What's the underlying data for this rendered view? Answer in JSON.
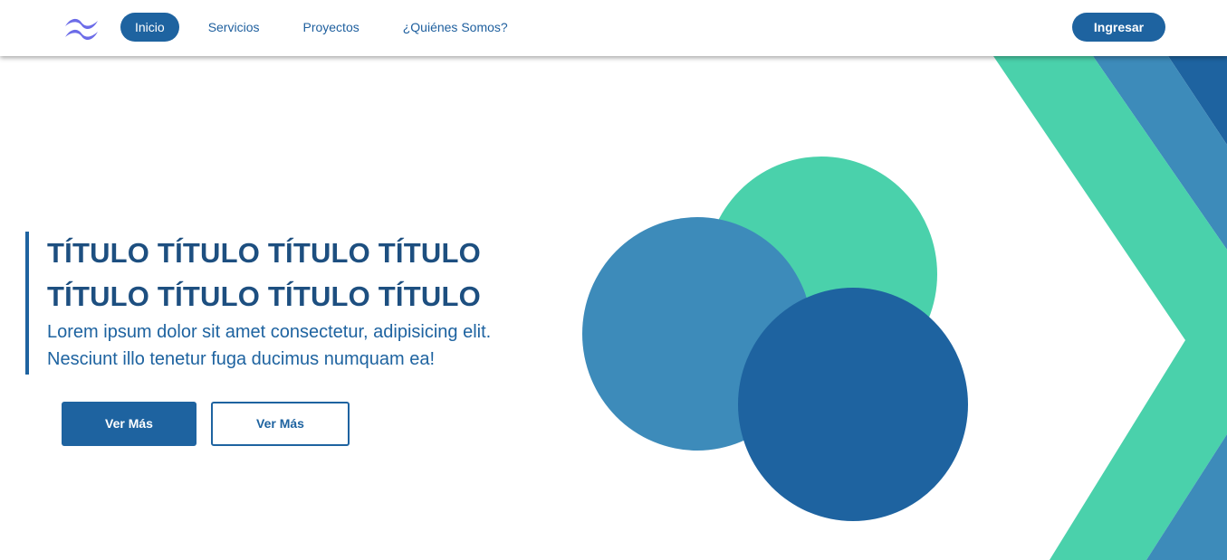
{
  "navbar": {
    "logo_icon": "tailwind-wave-logo",
    "items": [
      {
        "label": "Inicio",
        "active": true
      },
      {
        "label": "Servicios",
        "active": false
      },
      {
        "label": "Proyectos",
        "active": false
      },
      {
        "label": "¿Quiénes Somos?",
        "active": false
      }
    ],
    "login_label": "Ingresar"
  },
  "hero": {
    "title_line1": "TÍTULO TÍTULO TÍTULO TÍTULO",
    "title_line2": "TÍTULO TÍTULO TÍTULO TÍTULO",
    "subtitle_line1": "Lorem ipsum dolor sit amet consectetur, adipisicing elit.",
    "subtitle_line2": "Nesciunt illo tenetur fuga ducimus numquam ea!",
    "primary_button": "Ver Más",
    "secondary_button": "Ver Más"
  },
  "colors": {
    "primary": "#1e63a0",
    "mid_blue": "#3d8bba",
    "green": "#4ad1ab",
    "title": "#1d4f80",
    "logo": "#6c6ce8"
  }
}
